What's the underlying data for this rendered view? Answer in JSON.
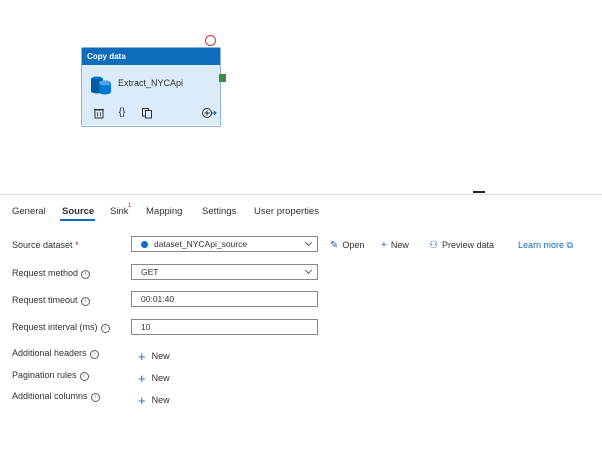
{
  "activity": {
    "type_label": "Copy data",
    "name": "Extract_NYCApi",
    "tools": [
      "delete-icon",
      "code-icon",
      "copy-icon",
      "add-output-icon"
    ]
  },
  "tabs": {
    "general": "General",
    "source": "Source",
    "sink": "Sink",
    "sink_badge": "1",
    "mapping": "Mapping",
    "settings": "Settings",
    "user_properties": "User properties"
  },
  "form": {
    "source_dataset_label": "Source dataset",
    "required_mark": "*",
    "source_dataset_value": "dataset_NYCApi_source",
    "open": "Open",
    "new": "New",
    "preview_data": "Preview data",
    "learn_more": "Learn more",
    "request_method_label": "Request method",
    "request_method_value": "GET",
    "request_timeout_label": "Request timeout",
    "request_timeout_value": "00:01:40",
    "request_interval_label": "Request interval (ms)",
    "request_interval_value": "10",
    "additional_headers_label": "Additional headers",
    "pagination_rules_label": "Pagination rules",
    "additional_columns_label": "Additional columns",
    "add_new": "New",
    "info_glyph": "i"
  },
  "colors": {
    "accent": "#0f6cbd",
    "header_bg": "#0f6cbd",
    "body_bg": "#dcebfa",
    "status": "#d13438",
    "port": "#3a8f3a"
  }
}
